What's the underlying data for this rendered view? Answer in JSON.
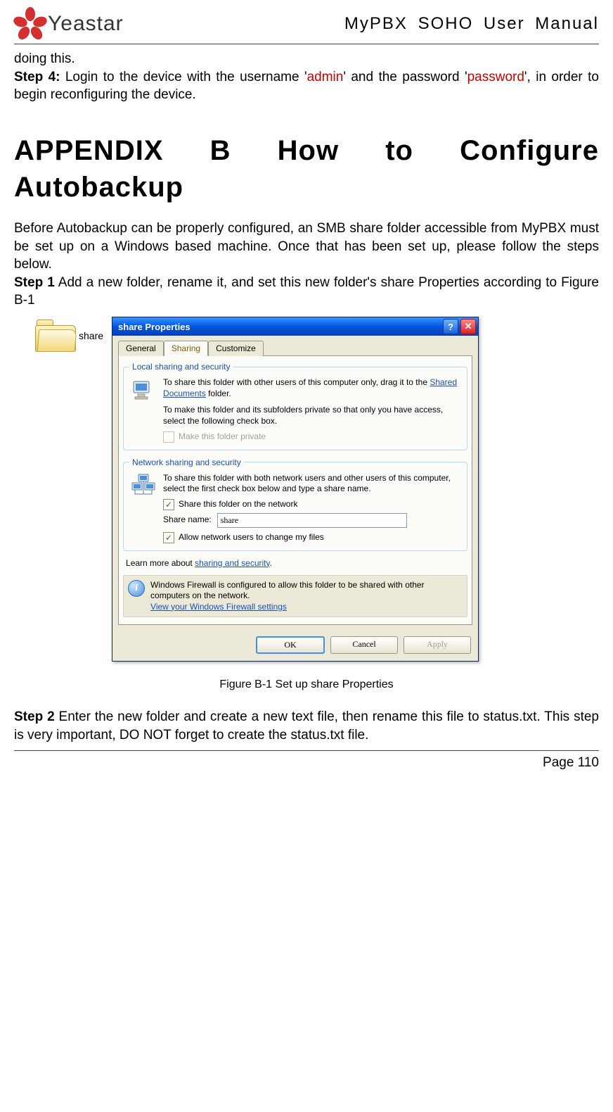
{
  "header": {
    "brand": "Yeastar",
    "manual_title": "MyPBX SOHO User Manual"
  },
  "intro": {
    "line_cont": "doing this.",
    "step4_label": "Step 4:",
    "step4_a": " Login to the device with the username '",
    "step4_user": "admin",
    "step4_b": "' and the password '",
    "step4_pass": "password",
    "step4_c": "', in order to begin reconfiguring the device."
  },
  "appendix_title": "APPENDIX B How to Configure Autobackup",
  "para1": "Before Autobackup can be properly configured, an SMB share folder accessible from MyPBX must be set up on a Windows based machine. Once that has been set up, please follow the steps below.",
  "step1_label": "Step 1",
  "step1_text": " Add a new folder, rename it, and set this new folder's share Properties according to Figure B-1",
  "folder_label": "share",
  "dialog": {
    "title": "share Properties",
    "tabs": {
      "general": "General",
      "sharing": "Sharing",
      "customize": "Customize"
    },
    "local": {
      "legend": "Local sharing and security",
      "line1a": "To share this folder with other users of this computer only, drag it to the ",
      "shared_docs_link": "Shared Documents",
      "line1b": " folder.",
      "line2": "To make this folder and its subfolders private so that only you have access, select the following check box.",
      "chk_private": "Make this folder private"
    },
    "net": {
      "legend": "Network sharing and security",
      "line1": "To share this folder with both network users and other users of this computer, select the first check box below and type a share name.",
      "chk_share": "Share this folder on the network",
      "share_name_label": "Share name:",
      "share_name_value": "share",
      "chk_allow": "Allow network users to change my files"
    },
    "learn_prefix": "Learn more about ",
    "learn_link": "sharing and security",
    "learn_suffix": ".",
    "firewall1": "Windows Firewall is configured to allow this folder to be shared with other computers on the network.",
    "firewall_link": "View your Windows Firewall settings",
    "buttons": {
      "ok": "OK",
      "cancel": "Cancel",
      "apply": "Apply"
    }
  },
  "figure_caption": "Figure B-1 Set up share Properties",
  "step2_label": "Step 2",
  "step2_text": " Enter the new folder and create a new text file, then rename this file to status.txt. This step is very important, DO NOT forget to create the status.txt file.",
  "footer": "Page 110"
}
